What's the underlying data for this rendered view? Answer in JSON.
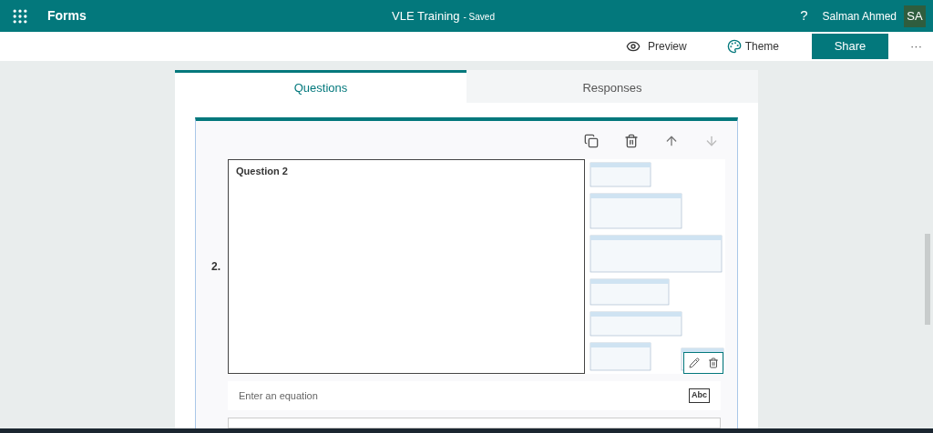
{
  "header": {
    "app_name": "Forms",
    "title": "VLE Training",
    "status": "- Saved",
    "help": "?",
    "user_name": "Salman Ahmed",
    "initials": "SA"
  },
  "toolbar": {
    "preview": "Preview",
    "theme": "Theme",
    "share": "Share",
    "more": "···"
  },
  "tabs": [
    {
      "label": "Questions",
      "selected": true
    },
    {
      "label": "Responses",
      "selected": false
    }
  ],
  "question": {
    "number": "2.",
    "title": "Question 2",
    "equation_placeholder": "Enter an equation",
    "equation_toggle": "Abc"
  }
}
